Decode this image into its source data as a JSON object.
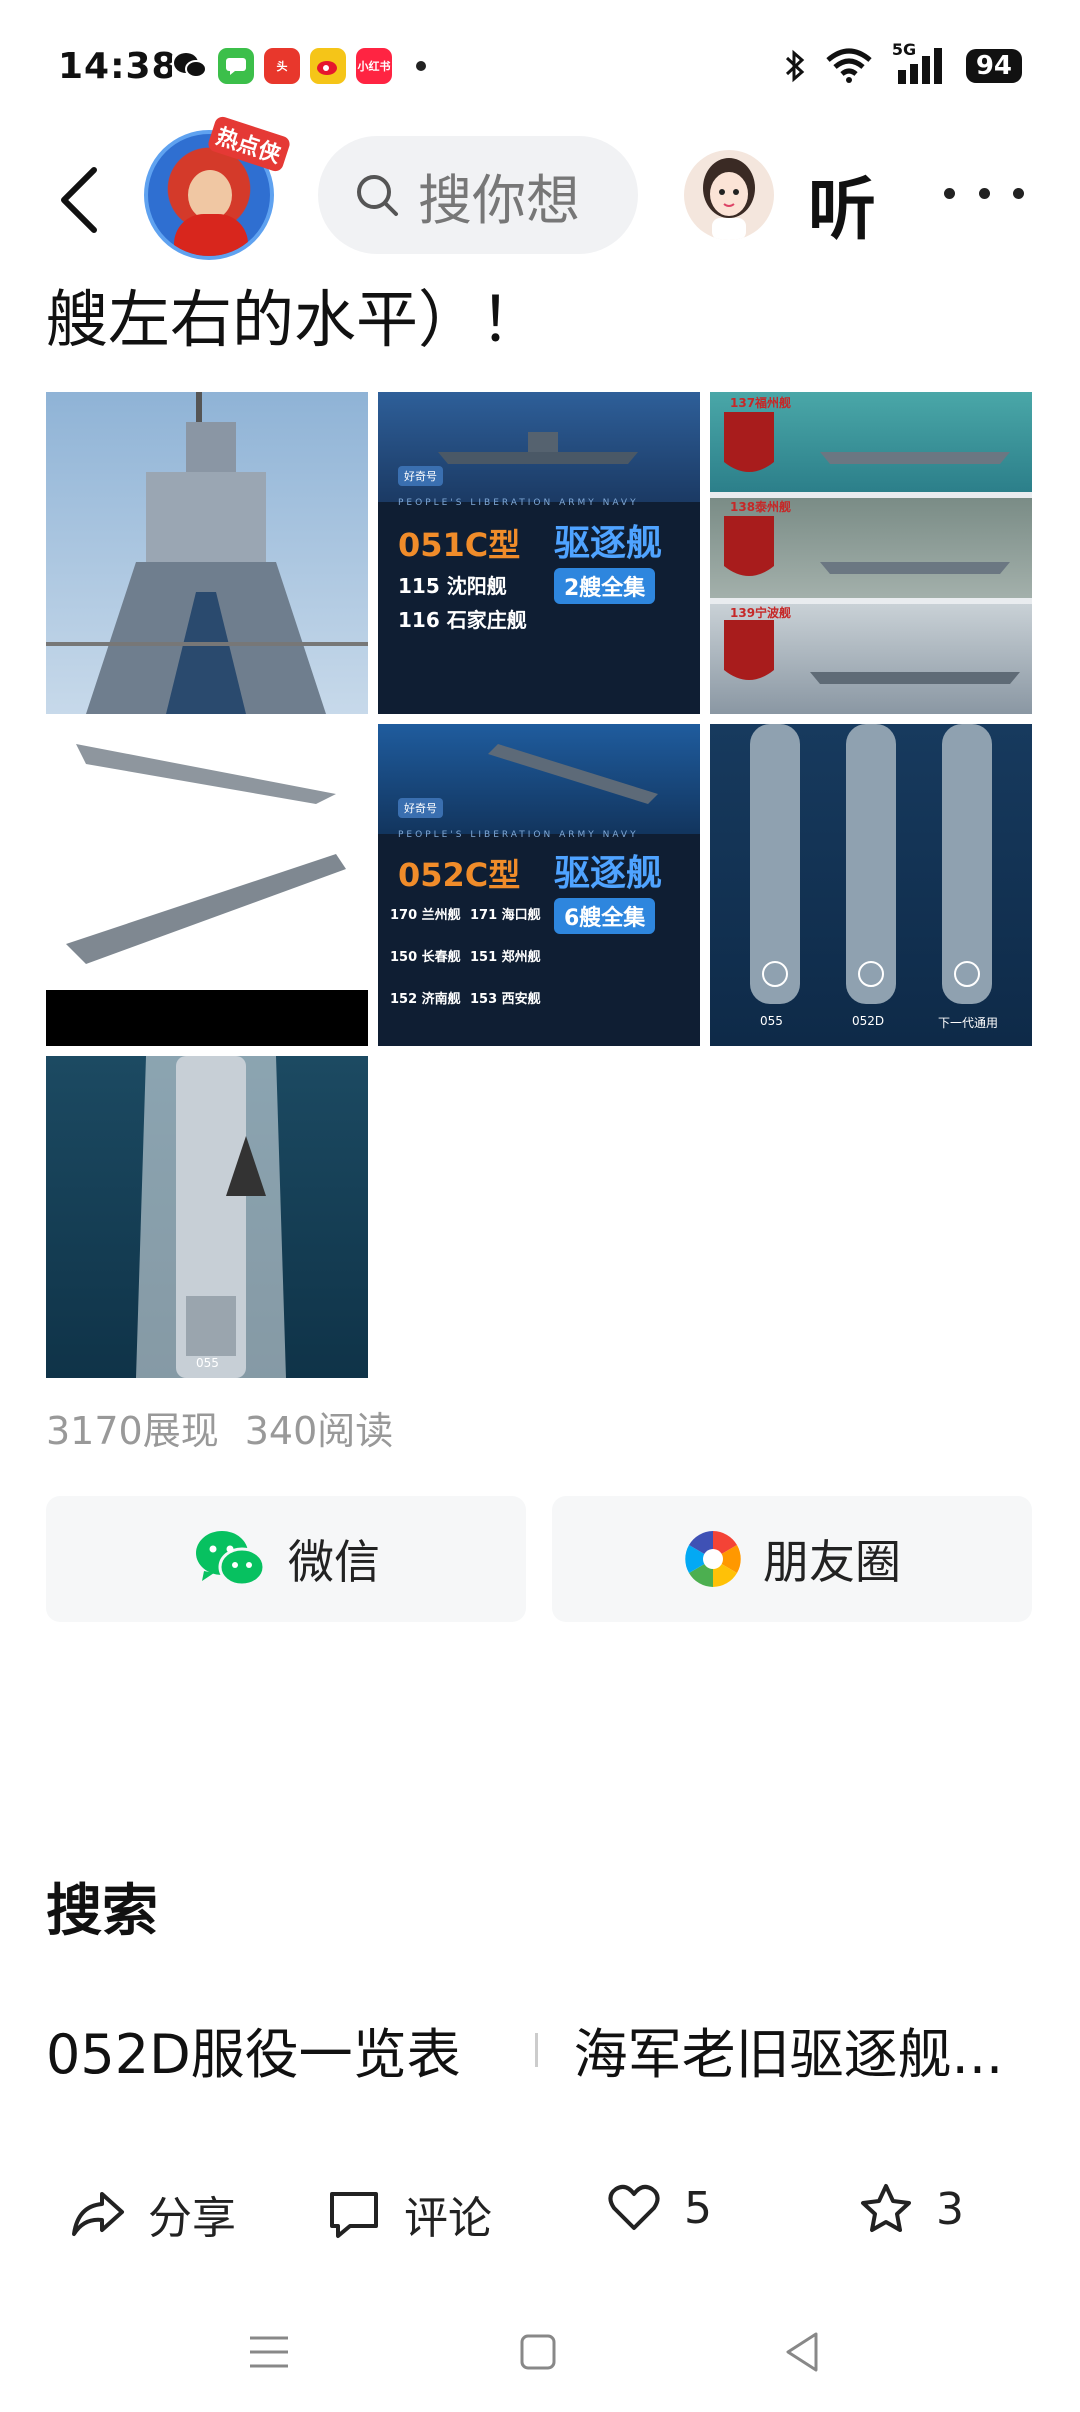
{
  "status_bar": {
    "time": "14:38",
    "notification_icons": [
      "wechat-icon",
      "messages-icon",
      "toutiao-icon",
      "weibo-icon",
      "xiaohongshu-icon"
    ],
    "xiaohongshu_text": "小红书",
    "network": "5G",
    "battery": "94"
  },
  "top_bar": {
    "avatar_badge": "热点侠",
    "search_placeholder": "搜你想",
    "listen_label": "听"
  },
  "post": {
    "text_tail": "艘左右的水平）！",
    "images": [
      {
        "overlay": []
      },
      {
        "brand": "好奇号",
        "subtitle": "PEOPLE'S LIBERATION ARMY NAVY",
        "type": "051C型",
        "class": "驱逐舰",
        "ships": [
          "115 沈阳舰",
          "116 石家庄舰"
        ],
        "badge": "2艘全集"
      },
      {
        "labels": [
          "137福州舰",
          "138泰州舰",
          "139宁波舰"
        ]
      },
      {
        "overlay": []
      },
      {
        "brand": "好奇号",
        "subtitle": "PEOPLE'S LIBERATION ARMY NAVY",
        "type": "052C型",
        "class": "驱逐舰",
        "ships": [
          "170 兰州舰",
          "171 海口舰",
          "150 长春舰",
          "151 郑州舰",
          "152 济南舰",
          "153 西安舰"
        ],
        "badge": "6艘全集"
      },
      {
        "labels": [
          "055",
          "052D",
          "下一代通用"
        ]
      },
      {
        "labels": [
          "055"
        ]
      }
    ],
    "impressions": "3170展现",
    "reads": "340阅读"
  },
  "share": {
    "wechat_label": "微信",
    "moments_label": "朋友圈"
  },
  "search_section": {
    "title": "搜索",
    "suggestions": [
      "052D服役一览表",
      "海军老旧驱逐舰..."
    ]
  },
  "actions": {
    "share_label": "分享",
    "comment_label": "评论",
    "like_count": "5",
    "favorite_count": "3"
  },
  "colors": {
    "wechat_green": "#07c160",
    "badge_red": "#e53935",
    "navy_dark": "#0f1e33"
  }
}
